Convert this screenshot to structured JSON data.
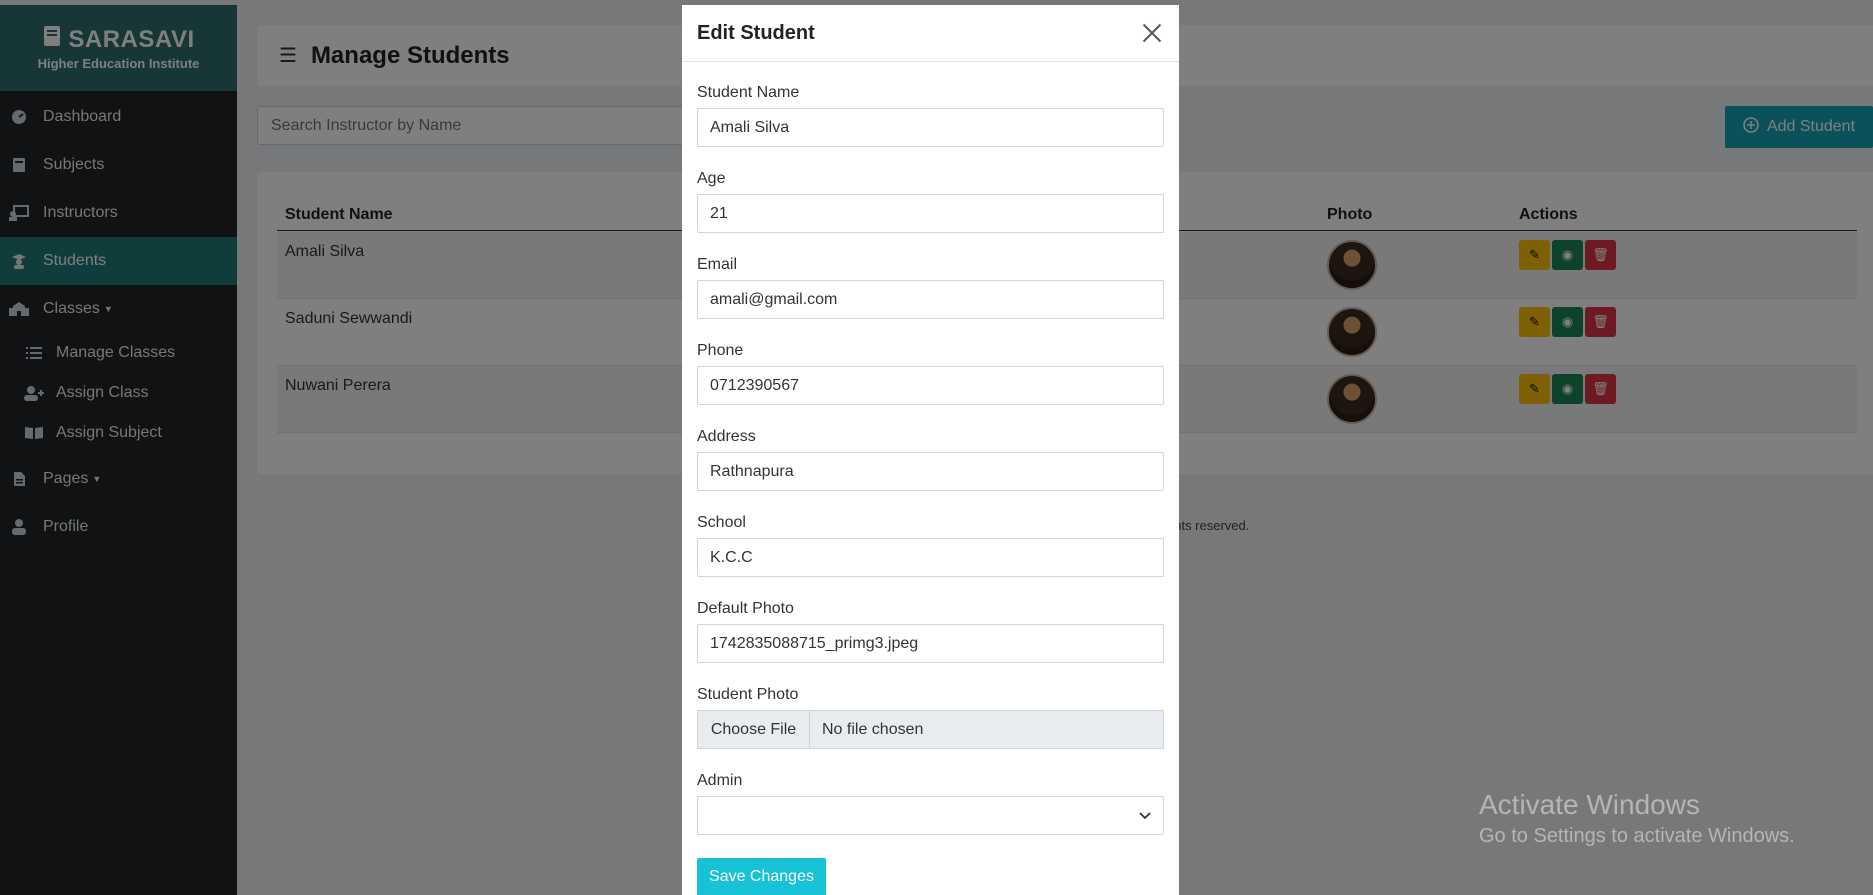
{
  "brand": {
    "name": "SARASAVI",
    "subtitle": "Higher Education Institute"
  },
  "sidebar": {
    "items": [
      {
        "label": "Dashboard",
        "icon": "tachometer-icon"
      },
      {
        "label": "Subjects",
        "icon": "book-icon"
      },
      {
        "label": "Instructors",
        "icon": "chalkboard-teacher-icon"
      },
      {
        "label": "Students",
        "icon": "graduate-icon",
        "active": true
      },
      {
        "label": "Classes",
        "icon": "school-icon"
      }
    ],
    "sub_items": [
      {
        "label": "Manage Classes",
        "icon": "list-icon"
      },
      {
        "label": "Assign Class",
        "icon": "user-plus-icon"
      },
      {
        "label": "Assign Subject",
        "icon": "open-book-icon"
      }
    ],
    "bottom_items": [
      {
        "label": "Pages",
        "icon": "file-icon"
      },
      {
        "label": "Profile",
        "icon": "user-icon"
      }
    ]
  },
  "header": {
    "title": "Manage Students"
  },
  "search": {
    "placeholder": "Search Instructor by Name"
  },
  "add_button": {
    "label": "Add Student"
  },
  "table": {
    "columns": [
      "Student Name",
      "Photo",
      "Actions"
    ],
    "rows": [
      {
        "name": "Amali Silva"
      },
      {
        "name": "Saduni Sewwandi"
      },
      {
        "name": "Nuwani Perera"
      }
    ]
  },
  "footer": {
    "text": "ghts reserved."
  },
  "watermark": {
    "line1": "Activate Windows",
    "line2": "Go to Settings to activate Windows."
  },
  "modal": {
    "title": "Edit Student",
    "fields": {
      "name": {
        "label": "Student Name",
        "value": "Amali Silva"
      },
      "age": {
        "label": "Age",
        "value": "21"
      },
      "email": {
        "label": "Email",
        "value": "amali@gmail.com"
      },
      "phone": {
        "label": "Phone",
        "value": "0712390567"
      },
      "address": {
        "label": "Address",
        "value": "Rathnapura"
      },
      "school": {
        "label": "School",
        "value": "K.C.C"
      },
      "default_photo": {
        "label": "Default Photo",
        "value": "1742835088715_primg3.jpeg"
      },
      "student_photo": {
        "label": "Student Photo",
        "choose": "Choose File",
        "status": "No file chosen"
      },
      "admin": {
        "label": "Admin",
        "value": ""
      }
    },
    "save_label": "Save Changes"
  },
  "colors": {
    "sidebar": "#212529",
    "brand": "#2f6d6d",
    "active": "#1e7a79",
    "accent": "#17a2b8"
  }
}
